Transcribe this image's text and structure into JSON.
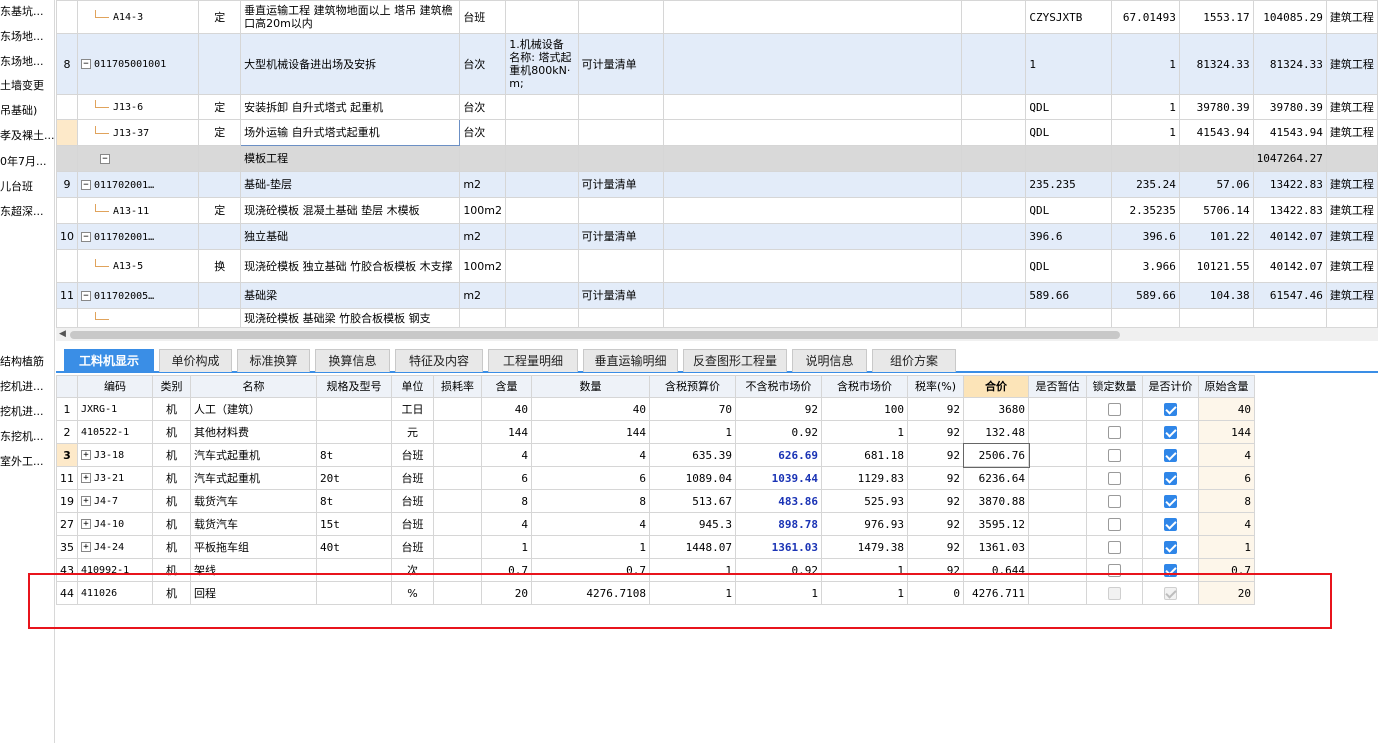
{
  "sidebar": {
    "items": [
      "东基坑...",
      "东场地...",
      "东场地...",
      "土墙变更",
      "吊基础)",
      "孝及裸土...",
      "0年7月...",
      "儿台班",
      "东超深...",
      "结构植筋",
      "挖机进...",
      "挖机进...",
      "东挖机...",
      "室外工..."
    ]
  },
  "top_grid": {
    "rows": [
      {
        "type": "child",
        "seq": "",
        "code": "A14-3",
        "kind": "定",
        "name": "垂直运输工程 建筑物地面以上 塔吊 建筑檐口高20m以内",
        "unit": "台班",
        "feature": "",
        "calc": "",
        "extra": "",
        "expr": "CZYSJXTB",
        "qty": "67.01493",
        "price": "1553.17",
        "total": "104085.29",
        "major": "建筑工程"
      },
      {
        "type": "list",
        "seq": "8",
        "code": "011705001001",
        "kind": "",
        "name": "大型机械设备进出场及安拆",
        "unit": "台次",
        "feature": "1.机械设备名称: 塔式起重机800kN·m;",
        "calc": "可计量清单",
        "extra": "",
        "expr": "1",
        "qty": "1",
        "price": "81324.33",
        "total": "81324.33",
        "major": "建筑工程"
      },
      {
        "type": "child",
        "seq": "",
        "code": "J13-6",
        "kind": "定",
        "name": "安装拆卸 自升式塔式 起重机",
        "unit": "台次",
        "feature": "",
        "calc": "",
        "extra": "",
        "expr": "QDL",
        "qty": "1",
        "price": "39780.39",
        "total": "39780.39",
        "major": "建筑工程"
      },
      {
        "type": "child-sel",
        "seq": "",
        "code": "J13-37",
        "kind": "定",
        "name": "场外运输 自升式塔式起重机",
        "unit": "台次",
        "feature": "",
        "calc": "",
        "extra": "",
        "expr": "QDL",
        "qty": "1",
        "price": "41543.94",
        "total": "41543.94",
        "major": "建筑工程"
      },
      {
        "type": "section",
        "seq": "",
        "code": "",
        "kind": "",
        "name": "模板工程",
        "unit": "",
        "feature": "",
        "calc": "",
        "extra": "",
        "expr": "",
        "qty": "",
        "price": "",
        "total": "1047264.27",
        "major": ""
      },
      {
        "type": "list",
        "seq": "9",
        "code": "011702001…",
        "kind": "",
        "name": "基础-垫层",
        "unit": "m2",
        "feature": "",
        "calc": "可计量清单",
        "extra": "",
        "expr": "235.235",
        "qty": "235.24",
        "price": "57.06",
        "total": "13422.83",
        "major": "建筑工程"
      },
      {
        "type": "child",
        "seq": "",
        "code": "A13-11",
        "kind": "定",
        "name": "现浇砼模板 混凝土基础 垫层 木模板",
        "unit": "100m2",
        "feature": "",
        "calc": "",
        "extra": "",
        "expr": "QDL",
        "qty": "2.35235",
        "price": "5706.14",
        "total": "13422.83",
        "major": "建筑工程"
      },
      {
        "type": "list",
        "seq": "10",
        "code": "011702001…",
        "kind": "",
        "name": "独立基础",
        "unit": "m2",
        "feature": "",
        "calc": "可计量清单",
        "extra": "",
        "expr": "396.6",
        "qty": "396.6",
        "price": "101.22",
        "total": "40142.07",
        "major": "建筑工程"
      },
      {
        "type": "child",
        "seq": "",
        "code": "A13-5",
        "kind": "换",
        "name": "现浇砼模板 独立基础 竹胶合板模板 木支撑",
        "unit": "100m2",
        "feature": "",
        "calc": "",
        "extra": "",
        "expr": "QDL",
        "qty": "3.966",
        "price": "10121.55",
        "total": "40142.07",
        "major": "建筑工程"
      },
      {
        "type": "list",
        "seq": "11",
        "code": "011702005…",
        "kind": "",
        "name": "基础梁",
        "unit": "m2",
        "feature": "",
        "calc": "可计量清单",
        "extra": "",
        "expr": "589.66",
        "qty": "589.66",
        "price": "104.38",
        "total": "61547.46",
        "major": "建筑工程"
      },
      {
        "type": "child",
        "seq": "",
        "code": "",
        "kind": "",
        "name": "现浇砼模板 基础梁 竹胶合板模板 钢支",
        "unit": "",
        "feature": "",
        "calc": "",
        "extra": "",
        "expr": "",
        "qty": "",
        "price": "",
        "total": "",
        "major": ""
      }
    ]
  },
  "tabs": [
    "工料机显示",
    "单价构成",
    "标准换算",
    "换算信息",
    "特征及内容",
    "工程量明细",
    "垂直运输明细",
    "反查图形工程量",
    "说明信息",
    "组价方案"
  ],
  "bottom_grid": {
    "headers": [
      "",
      "编码",
      "类别",
      "名称",
      "规格及型号",
      "单位",
      "损耗率",
      "含量",
      "数量",
      "含税预算价",
      "不含税市场价",
      "含税市场价",
      "税率(%)",
      "合价",
      "是否暂估",
      "锁定数量",
      "是否计价",
      "原始含量"
    ],
    "rows": [
      {
        "seq": "1",
        "code": "JXRG-1",
        "cat": "机",
        "name": "人工（建筑）",
        "spec": "",
        "unit": "工日",
        "loss": "",
        "content": "40",
        "qty": "40",
        "budget": "70",
        "market": "92",
        "market_tax": "100",
        "rate": "92",
        "total": "3680",
        "orig": "40",
        "expand": false,
        "lock": "off",
        "price_flag": "on"
      },
      {
        "seq": "2",
        "code": "410522-1",
        "cat": "机",
        "name": "其他材料费",
        "spec": "",
        "unit": "元",
        "loss": "",
        "content": "144",
        "qty": "144",
        "budget": "1",
        "market": "0.92",
        "market_tax": "1",
        "rate": "92",
        "total": "132.48",
        "orig": "144",
        "expand": false,
        "lock": "off",
        "price_flag": "on"
      },
      {
        "seq": "3",
        "code": "J3-18",
        "cat": "机",
        "name": "汽车式起重机",
        "spec": "8t",
        "unit": "台班",
        "loss": "",
        "content": "4",
        "qty": "4",
        "budget": "635.39",
        "market": "626.69",
        "market_tax": "681.18",
        "rate": "92",
        "total": "2506.76",
        "orig": "4",
        "expand": true,
        "lock": "off",
        "price_flag": "on"
      },
      {
        "seq": "11",
        "code": "J3-21",
        "cat": "机",
        "name": "汽车式起重机",
        "spec": "20t",
        "unit": "台班",
        "loss": "",
        "content": "6",
        "qty": "6",
        "budget": "1089.04",
        "market": "1039.44",
        "market_tax": "1129.83",
        "rate": "92",
        "total": "6236.64",
        "orig": "6",
        "expand": true,
        "lock": "off",
        "price_flag": "on"
      },
      {
        "seq": "19",
        "code": "J4-7",
        "cat": "机",
        "name": "载货汽车",
        "spec": "8t",
        "unit": "台班",
        "loss": "",
        "content": "8",
        "qty": "8",
        "budget": "513.67",
        "market": "483.86",
        "market_tax": "525.93",
        "rate": "92",
        "total": "3870.88",
        "orig": "8",
        "expand": true,
        "lock": "off",
        "price_flag": "on"
      },
      {
        "seq": "27",
        "code": "J4-10",
        "cat": "机",
        "name": "载货汽车",
        "spec": "15t",
        "unit": "台班",
        "loss": "",
        "content": "4",
        "qty": "4",
        "budget": "945.3",
        "market": "898.78",
        "market_tax": "976.93",
        "rate": "92",
        "total": "3595.12",
        "orig": "4",
        "expand": true,
        "lock": "off",
        "price_flag": "on"
      },
      {
        "seq": "35",
        "code": "J4-24",
        "cat": "机",
        "name": "平板拖车组",
        "spec": "40t",
        "unit": "台班",
        "loss": "",
        "content": "1",
        "qty": "1",
        "budget": "1448.07",
        "market": "1361.03",
        "market_tax": "1479.38",
        "rate": "92",
        "total": "1361.03",
        "orig": "1",
        "expand": true,
        "lock": "off",
        "price_flag": "on"
      },
      {
        "seq": "43",
        "code": "410992-1",
        "cat": "机",
        "name": "架线",
        "spec": "",
        "unit": "次",
        "loss": "",
        "content": "0.7",
        "qty": "0.7",
        "budget": "1",
        "market": "0.92",
        "market_tax": "1",
        "rate": "92",
        "total": "0.644",
        "orig": "0.7",
        "expand": false,
        "lock": "off",
        "price_flag": "on"
      },
      {
        "seq": "44",
        "code": "411026",
        "cat": "机",
        "name": "回程",
        "spec": "",
        "unit": "%",
        "loss": "",
        "content": "20",
        "qty": "4276.7108",
        "budget": "1",
        "market": "1",
        "market_tax": "1",
        "rate": "0",
        "total": "4276.711",
        "orig": "20",
        "expand": false,
        "lock": "dis",
        "price_flag": "dison"
      }
    ]
  },
  "colors": {
    "accent": "#3a8ee6",
    "highlight_box": "#e8141c",
    "blue_value": "#1a33b5"
  }
}
